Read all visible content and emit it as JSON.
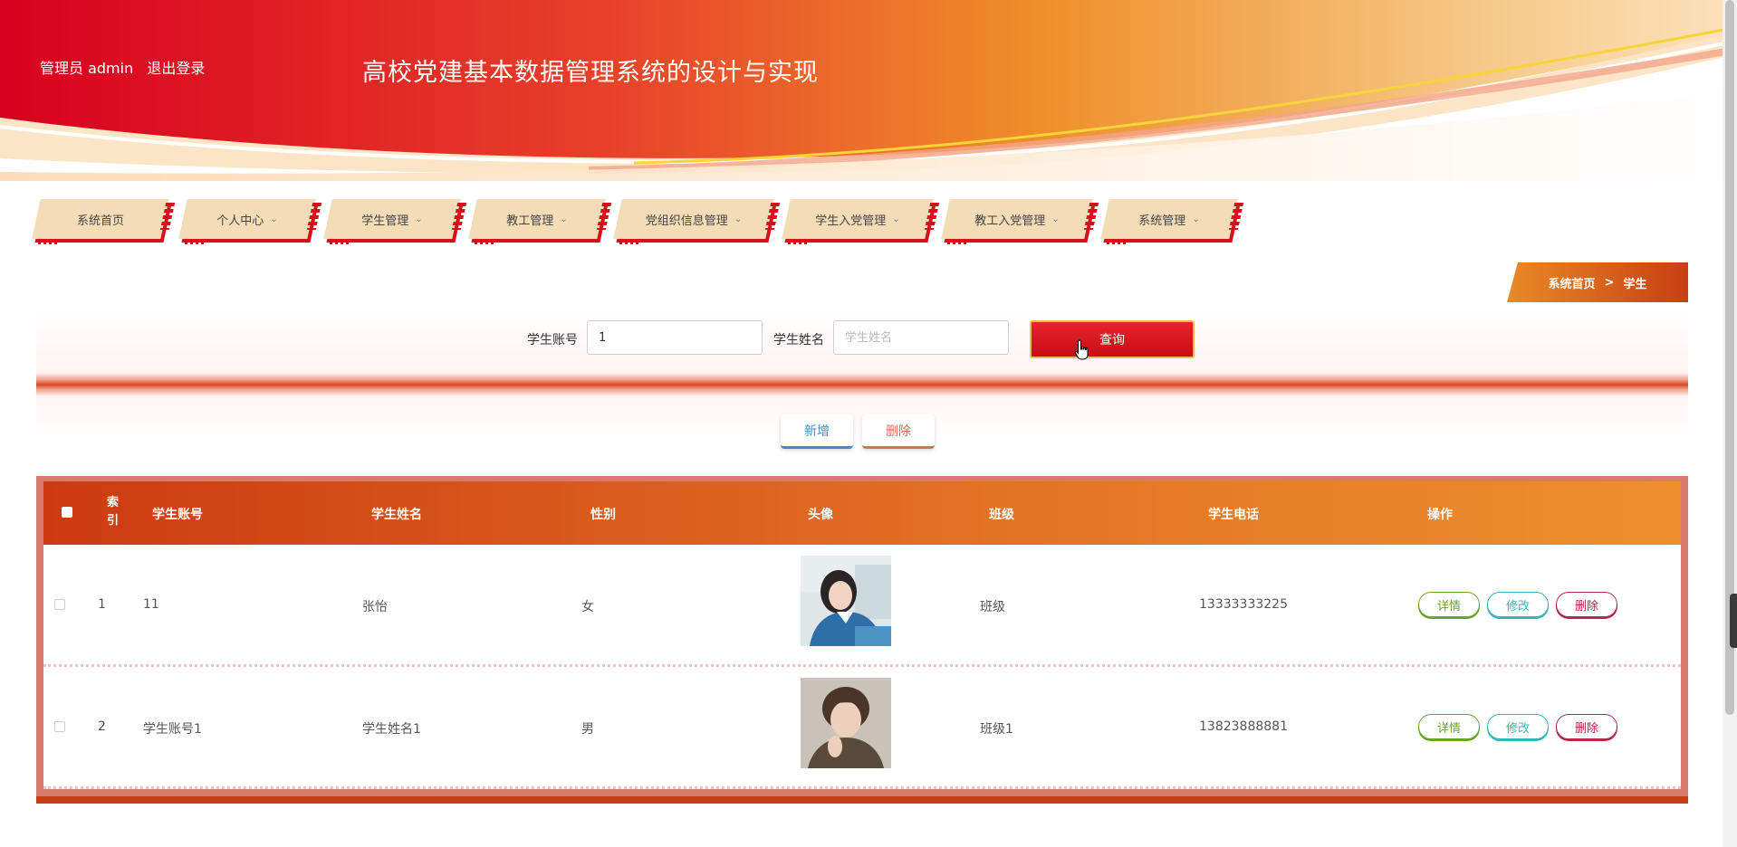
{
  "header": {
    "user_label": "管理员 admin",
    "logout_label": "退出登录",
    "site_title": "高校党建基本数据管理系统的设计与实现"
  },
  "nav": {
    "items": [
      {
        "label": "系统首页",
        "has_dropdown": false
      },
      {
        "label": "个人中心",
        "has_dropdown": true
      },
      {
        "label": "学生管理",
        "has_dropdown": true
      },
      {
        "label": "教工管理",
        "has_dropdown": true
      },
      {
        "label": "党组织信息管理",
        "has_dropdown": true
      },
      {
        "label": "学生入党管理",
        "has_dropdown": true
      },
      {
        "label": "教工入党管理",
        "has_dropdown": true
      },
      {
        "label": "系统管理",
        "has_dropdown": true
      }
    ]
  },
  "breadcrumb": {
    "home": "系统首页",
    "separator": ">",
    "current": "学生"
  },
  "search": {
    "account_label": "学生账号",
    "account_value": "1",
    "name_label": "学生姓名",
    "name_placeholder": "学生姓名",
    "query_label": "查询"
  },
  "actions": {
    "add_label": "新增",
    "delete_label": "删除"
  },
  "table": {
    "headers": {
      "index": "索引",
      "account": "学生账号",
      "name": "学生姓名",
      "gender": "性别",
      "avatar": "头像",
      "class": "班级",
      "phone": "学生电话",
      "ops": "操作"
    },
    "rows": [
      {
        "index": "1",
        "account": "11",
        "name": "张怡",
        "gender": "女",
        "class": "班级",
        "phone": "13333333225"
      },
      {
        "index": "2",
        "account": "学生账号1",
        "name": "学生姓名1",
        "gender": "男",
        "class": "班级1",
        "phone": "13823888881"
      }
    ],
    "op_labels": {
      "detail": "详情",
      "edit": "修改",
      "delete": "删除"
    }
  },
  "colors": {
    "primary_red": "#d8101c",
    "banner_orange": "#e98a26",
    "nav_bg": "#f4dcb7",
    "detail_green": "#6aa42a",
    "edit_teal": "#36b7b3",
    "delete_crimson": "#b8274c"
  }
}
